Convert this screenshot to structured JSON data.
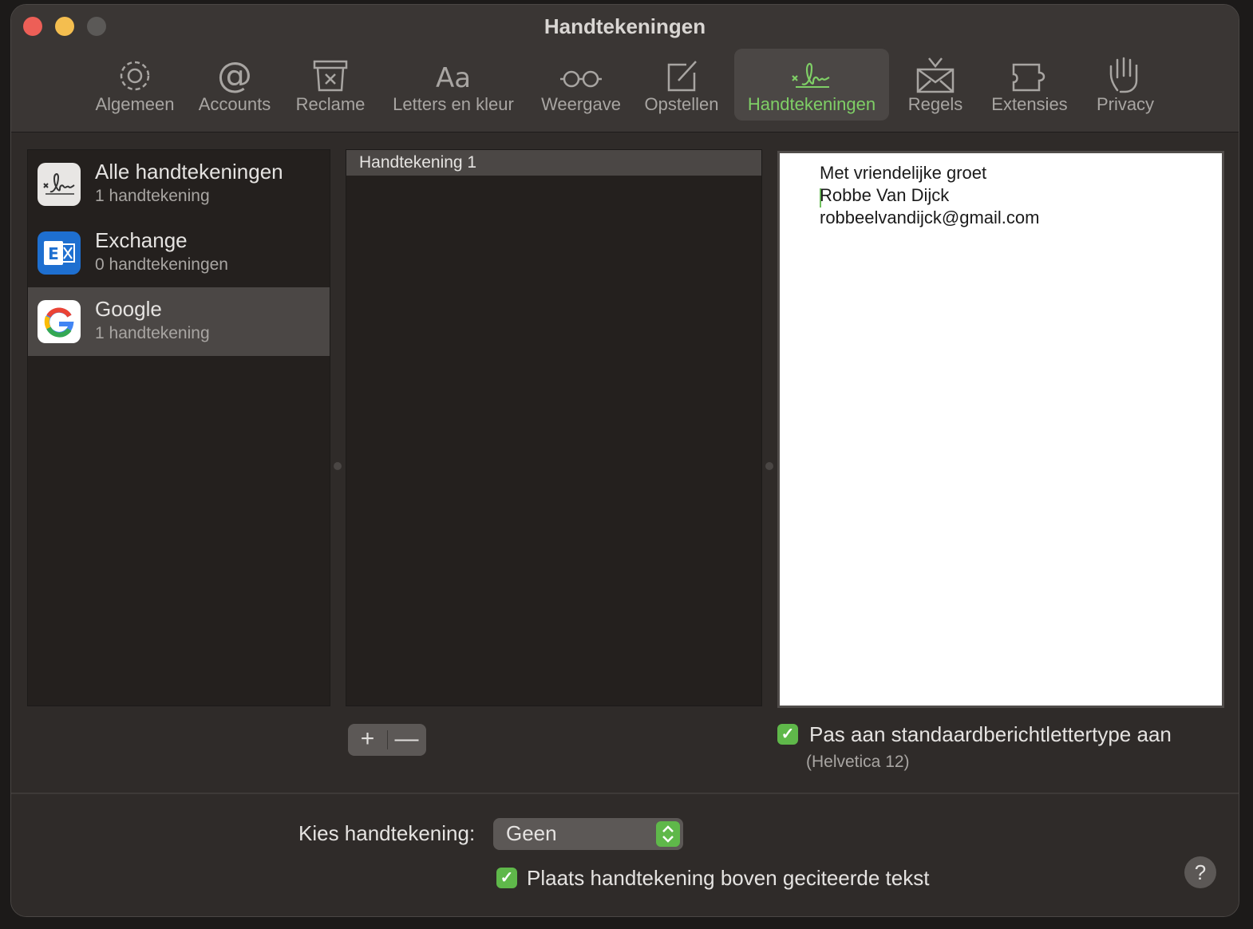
{
  "window": {
    "title": "Handtekeningen"
  },
  "toolbar": {
    "items": [
      {
        "label": "Algemeen",
        "icon": "gear-icon"
      },
      {
        "label": "Accounts",
        "icon": "at-icon"
      },
      {
        "label": "Reclame",
        "icon": "junk-icon"
      },
      {
        "label": "Letters en kleur",
        "icon": "fonts-icon"
      },
      {
        "label": "Weergave",
        "icon": "glasses-icon"
      },
      {
        "label": "Opstellen",
        "icon": "compose-icon"
      },
      {
        "label": "Handtekeningen",
        "icon": "signature-icon"
      },
      {
        "label": "Regels",
        "icon": "rules-icon"
      },
      {
        "label": "Extensies",
        "icon": "puzzle-icon"
      },
      {
        "label": "Privacy",
        "icon": "hand-icon"
      }
    ],
    "active": "Handtekeningen",
    "accent_color": "#7fcf66"
  },
  "accounts": [
    {
      "name": "Alle handtekeningen",
      "count": "1 handtekening",
      "icon": "signature-icon"
    },
    {
      "name": "Exchange",
      "count": "0 handtekeningen",
      "icon": "exchange-icon"
    },
    {
      "name": "Google",
      "count": "1 handtekening",
      "icon": "google-icon"
    }
  ],
  "selected_account": "Google",
  "signatures": [
    {
      "name": "Handtekening 1"
    }
  ],
  "editor": {
    "lines": [
      "Met vriendelijke groet",
      "Robbe Van Dijck",
      "robbeelvandijck@gmail.com"
    ]
  },
  "buttons": {
    "add": "+",
    "remove": "—"
  },
  "font_option": {
    "label": "Pas aan standaardberichtlettertype aan",
    "sub": "(Helvetica 12)",
    "checked": true
  },
  "bottom": {
    "kies_label": "Kies handtekening:",
    "kies_value": "Geen",
    "above_quote_label": "Plaats handtekening boven geciteerde tekst",
    "above_quote_checked": true,
    "help": "?"
  }
}
